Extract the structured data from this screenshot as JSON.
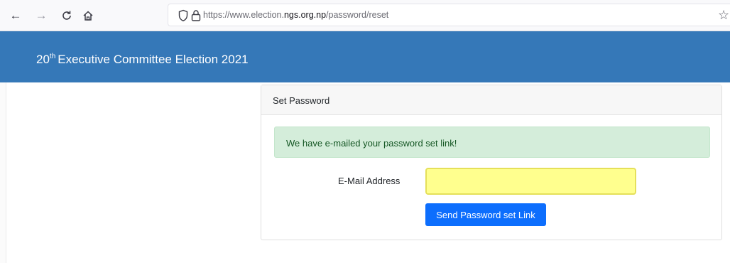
{
  "browser": {
    "back_icon": "arrow-left-icon",
    "forward_icon": "arrow-right-icon",
    "reload_icon": "reload-icon",
    "home_icon": "home-icon",
    "shield_icon": "shield-icon",
    "lock_icon": "lock-icon",
    "url_prefix": "https://www.election.",
    "url_host": "ngs.org.np",
    "url_path": "/password/reset"
  },
  "header": {
    "title_ordinal": "20",
    "title_suffix": "th",
    "title_rest": "Executive Committee Election 2021",
    "background": "#3578b8"
  },
  "card": {
    "title": "Set Password",
    "alert_message": "We have e-mailed your password set link!",
    "email_label": "E-Mail Address",
    "email_value": "",
    "submit_label": "Send Password set Link"
  },
  "colors": {
    "alert_bg": "#d4edda",
    "alert_text": "#155724",
    "input_highlight": "#ffff8e",
    "button": "#0d6efd"
  }
}
